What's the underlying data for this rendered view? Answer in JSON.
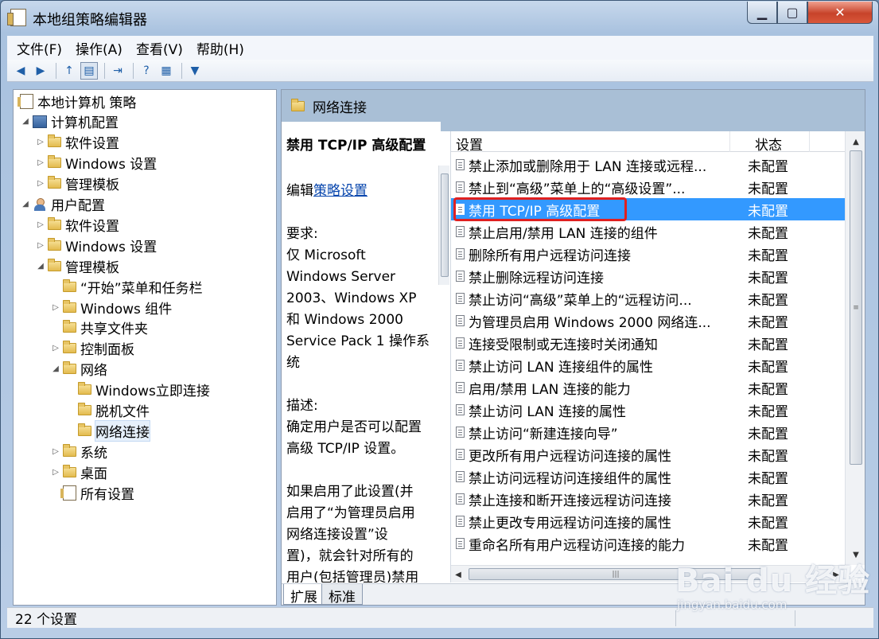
{
  "window": {
    "title": "本地组策略编辑器",
    "min_glyph": "▁",
    "max_glyph": "▢",
    "close_glyph": "✕"
  },
  "menu": [
    {
      "id": "file",
      "label": "文件(F)"
    },
    {
      "id": "action",
      "label": "操作(A)"
    },
    {
      "id": "view",
      "label": "查看(V)"
    },
    {
      "id": "help",
      "label": "帮助(H)"
    }
  ],
  "toolbar": {
    "back_glyph": "◀",
    "forward_glyph": "▶",
    "up_glyph": "↑",
    "showhide_glyph": "▤",
    "export_glyph": "⇥",
    "help_glyph": "?",
    "properties_glyph": "▦",
    "filter_glyph": "▼"
  },
  "tree": [
    {
      "id": "root",
      "label": "本地计算机 策略",
      "level": 0,
      "icon": "policy",
      "arrow": ""
    },
    {
      "id": "computer-config",
      "label": "计算机配置",
      "level": 1,
      "icon": "computer",
      "arrow": "◢"
    },
    {
      "id": "cc-software",
      "label": "软件设置",
      "level": 2,
      "icon": "folder",
      "arrow": "▷"
    },
    {
      "id": "cc-windows",
      "label": "Windows 设置",
      "level": 2,
      "icon": "folder",
      "arrow": "▷"
    },
    {
      "id": "cc-admin",
      "label": "管理模板",
      "level": 2,
      "icon": "folder",
      "arrow": "▷"
    },
    {
      "id": "user-config",
      "label": "用户配置",
      "level": 1,
      "icon": "user",
      "arrow": "◢"
    },
    {
      "id": "uc-software",
      "label": "软件设置",
      "level": 2,
      "icon": "folder",
      "arrow": "▷"
    },
    {
      "id": "uc-windows",
      "label": "Windows 设置",
      "level": 2,
      "icon": "folder",
      "arrow": "▷"
    },
    {
      "id": "uc-admin",
      "label": "管理模板",
      "level": 2,
      "icon": "folder",
      "arrow": "◢"
    },
    {
      "id": "start-menu",
      "label": "“开始”菜单和任务栏",
      "level": 3,
      "icon": "folder",
      "arrow": ""
    },
    {
      "id": "win-components",
      "label": "Windows 组件",
      "level": 3,
      "icon": "folder",
      "arrow": "▷"
    },
    {
      "id": "shared-folders",
      "label": "共享文件夹",
      "level": 3,
      "icon": "folder",
      "arrow": ""
    },
    {
      "id": "control-panel",
      "label": "控制面板",
      "level": 3,
      "icon": "folder",
      "arrow": "▷"
    },
    {
      "id": "network",
      "label": "网络",
      "level": 3,
      "icon": "folder",
      "arrow": "◢"
    },
    {
      "id": "win-connect-now",
      "label": "Windows立即连接",
      "level": 4,
      "icon": "folder",
      "arrow": ""
    },
    {
      "id": "offline-files",
      "label": "脱机文件",
      "level": 4,
      "icon": "folder",
      "arrow": ""
    },
    {
      "id": "net-connections",
      "label": "网络连接",
      "level": 4,
      "icon": "folder",
      "arrow": "",
      "selected": true
    },
    {
      "id": "system",
      "label": "系统",
      "level": 3,
      "icon": "folder",
      "arrow": "▷"
    },
    {
      "id": "desktop",
      "label": "桌面",
      "level": 3,
      "icon": "folder",
      "arrow": "▷"
    },
    {
      "id": "all-settings",
      "label": "所有设置",
      "level": 3,
      "icon": "policy",
      "arrow": ""
    }
  ],
  "panel": {
    "header": "网络连接"
  },
  "description": {
    "title": "禁用 TCP/IP 高级配置",
    "edit_prefix": "编辑",
    "edit_link": "策略设置",
    "lines": [
      "",
      "要求:",
      "仅 Microsoft",
      "Windows Server",
      "2003、Windows XP",
      "和 Windows 2000",
      "Service Pack 1 操作系",
      "统",
      "",
      "描述:",
      "确定用户是否可以配置",
      "高级 TCP/IP 设置。",
      "",
      "如果启用了此设置(并",
      "启用了“为管理员启用",
      "网络连接设置”设",
      "置)，就会针对所有的",
      "用户(包括管理员)禁用"
    ]
  },
  "list": {
    "columns": {
      "setting": "设置",
      "state": "状态"
    },
    "rows": [
      {
        "name": "禁止添加或删除用于 LAN 连接或远程...",
        "state": "未配置"
      },
      {
        "name": "禁止到“高级”菜单上的“高级设置”...",
        "state": "未配置"
      },
      {
        "name": "禁用 TCP/IP 高级配置",
        "state": "未配置",
        "selected": true
      },
      {
        "name": "禁止启用/禁用 LAN 连接的组件",
        "state": "未配置"
      },
      {
        "name": "删除所有用户远程访问连接",
        "state": "未配置"
      },
      {
        "name": "禁止删除远程访问连接",
        "state": "未配置"
      },
      {
        "name": "禁止访问“高级”菜单上的“远程访问...",
        "state": "未配置"
      },
      {
        "name": "为管理员启用 Windows 2000 网络连...",
        "state": "未配置"
      },
      {
        "name": "连接受限制或无连接时关闭通知",
        "state": "未配置"
      },
      {
        "name": "禁止访问 LAN 连接组件的属性",
        "state": "未配置"
      },
      {
        "name": "启用/禁用 LAN 连接的能力",
        "state": "未配置"
      },
      {
        "name": "禁止访问 LAN 连接的属性",
        "state": "未配置"
      },
      {
        "name": "禁止访问“新建连接向导”",
        "state": "未配置"
      },
      {
        "name": "更改所有用户远程访问连接的属性",
        "state": "未配置"
      },
      {
        "name": "禁止访问远程访问连接组件的属性",
        "state": "未配置"
      },
      {
        "name": "禁止连接和断开连接远程访问连接",
        "state": "未配置"
      },
      {
        "name": "禁止更改专用远程访问连接的属性",
        "state": "未配置"
      },
      {
        "name": "重命名所有用户远程访问连接的能力",
        "state": "未配置"
      }
    ]
  },
  "tabs": [
    {
      "id": "expand",
      "label": "扩展"
    },
    {
      "id": "standard",
      "label": "标准"
    }
  ],
  "status": {
    "text": "22 个设置"
  },
  "watermark": {
    "logo": "Bai du 经验",
    "sub": "jingyan.baidu.com"
  }
}
